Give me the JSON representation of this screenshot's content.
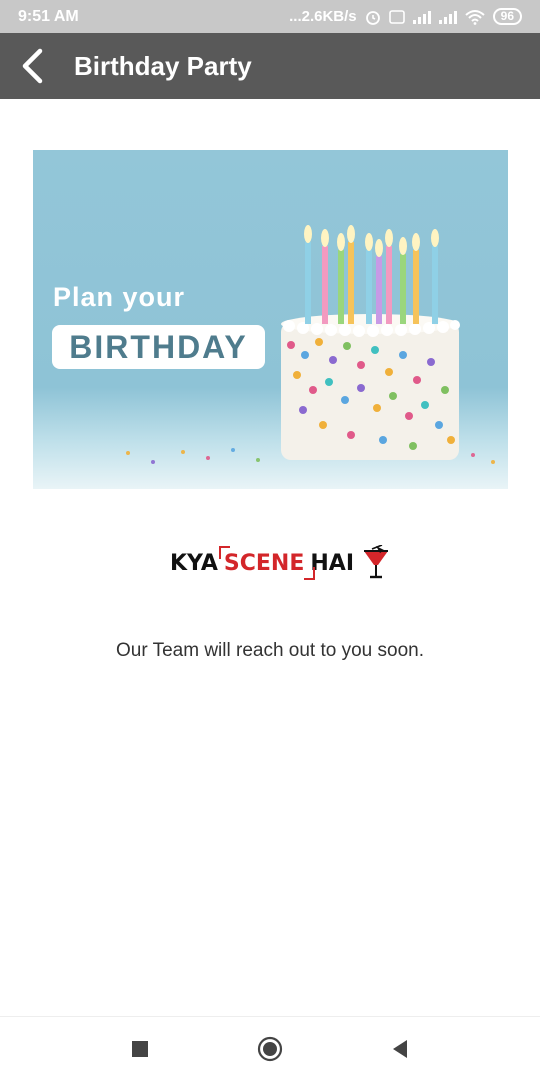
{
  "status_bar": {
    "time": "9:51 AM",
    "network_speed": "...2.6KB/s",
    "battery": "96"
  },
  "app_bar": {
    "title": "Birthday Party"
  },
  "banner": {
    "line1": "Plan your",
    "line2": "BIRTHDAY"
  },
  "logo": {
    "part1": "KYA",
    "part2": "SCENE",
    "part3": "HAI"
  },
  "message": "Our Team will reach out to you soon.",
  "colors": {
    "app_bar": "#595959",
    "status_bar": "#c8c8c8",
    "logo_accent": "#d3262a"
  }
}
